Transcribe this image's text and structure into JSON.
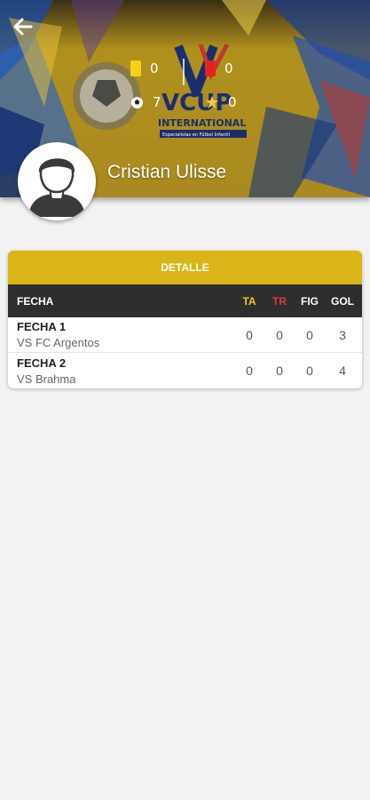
{
  "header": {
    "back_icon": "arrow-left-icon",
    "stats": {
      "yellow_cards": "0",
      "red_cards": "0",
      "goals": "7",
      "figure": "0"
    },
    "logo_text": "VCUP",
    "logo_subtext": "INTERNATIONAL",
    "logo_tagline": "Especialistas en Fútbol Infantil",
    "player_name": "Cristian Ulisse"
  },
  "detail": {
    "title": "DETALLE",
    "columns": {
      "fecha": "FECHA",
      "ta": "TA",
      "tr": "TR",
      "fig": "FIG",
      "gol": "GOL"
    },
    "rows": [
      {
        "fecha": "FECHA 1",
        "rival": "VS FC Argentos",
        "ta": "0",
        "tr": "0",
        "fig": "0",
        "gol": "3"
      },
      {
        "fecha": "FECHA 2",
        "rival": "VS Brahma",
        "ta": "0",
        "tr": "0",
        "fig": "0",
        "gol": "4"
      }
    ]
  },
  "colors": {
    "gold": "#d9b518",
    "dark_header": "#2e2e2e",
    "ta": "#e9cf14",
    "tr": "#e23b2a"
  }
}
